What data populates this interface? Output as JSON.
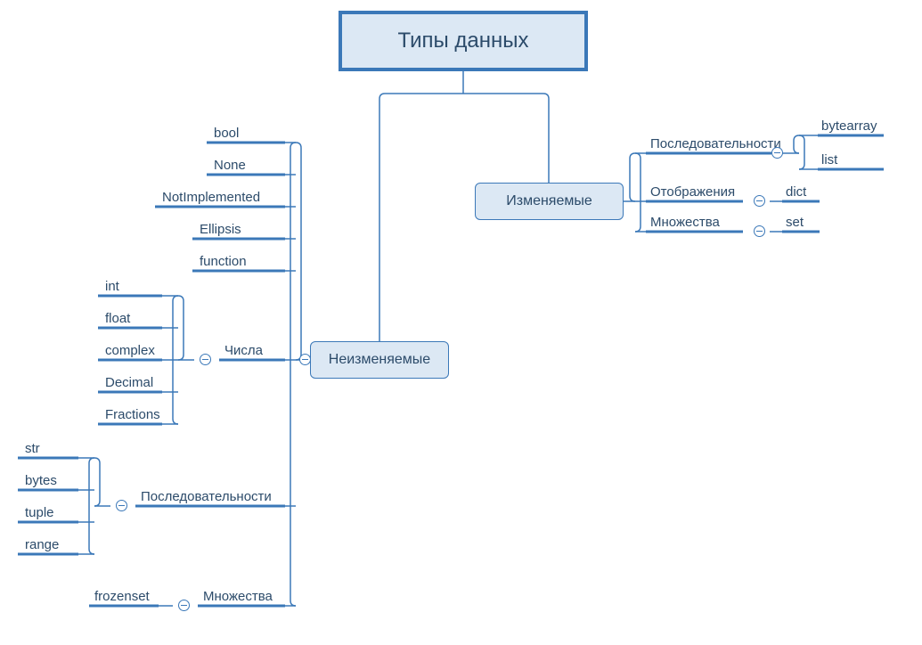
{
  "root": {
    "title": "Типы данных"
  },
  "mutable": {
    "title": "Изменяемые",
    "sequences": {
      "label": "Последовательности",
      "items": [
        "bytearray",
        "list"
      ]
    },
    "mappings": {
      "label": "Отображения",
      "items": [
        "dict"
      ]
    },
    "sets": {
      "label": "Множества",
      "items": [
        "set"
      ]
    }
  },
  "immutable": {
    "title": "Неизменяемые",
    "simple": [
      "bool",
      "None",
      "NotImplemented",
      "Ellipsis",
      "function"
    ],
    "numbers": {
      "label": "Числа",
      "items": [
        "int",
        "float",
        "complex",
        "Decimal",
        "Fractions"
      ]
    },
    "sequences": {
      "label": "Последовательности",
      "items": [
        "str",
        "bytes",
        "tuple",
        "range"
      ]
    },
    "sets": {
      "label": "Множества",
      "items": [
        "frozenset"
      ]
    }
  },
  "colors": {
    "stroke": "#3b78b8",
    "fill": "#dce8f4",
    "text": "#2c4b6a"
  }
}
